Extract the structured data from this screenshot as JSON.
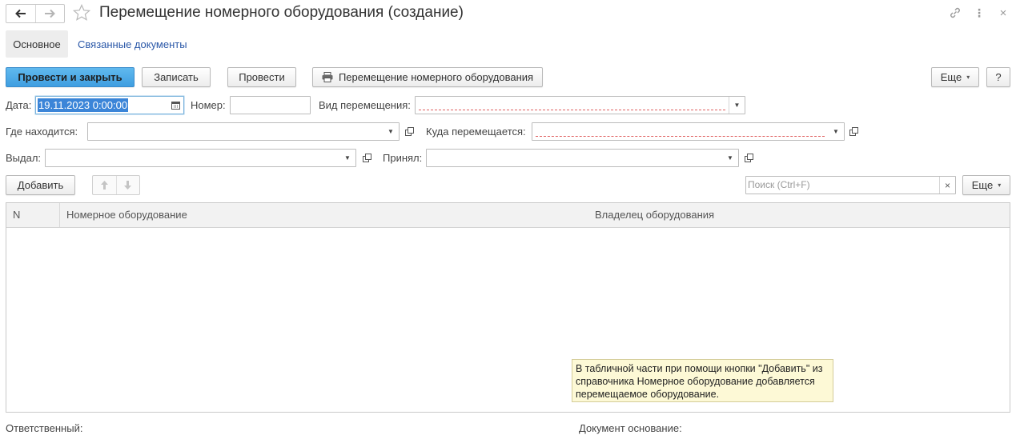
{
  "window": {
    "title": "Перемещение номерного оборудования (создание)",
    "menu_glyph": "⋮",
    "close_glyph": "×"
  },
  "tabs": [
    {
      "label": "Основное",
      "active": true
    },
    {
      "label": "Связанные документы",
      "active": false
    }
  ],
  "toolbar": {
    "post_close": "Провести и закрыть",
    "save": "Записать",
    "post": "Провести",
    "print": "Перемещение номерного оборудования",
    "more": "Еще",
    "help": "?"
  },
  "form": {
    "date_label": "Дата:",
    "date_value": "19.11.2023  0:00:00",
    "number_label": "Номер:",
    "number_value": "",
    "move_type_label": "Вид перемещения:",
    "move_type_value": "",
    "location_label": "Где находится:",
    "location_value": "",
    "destination_label": "Куда перемещается:",
    "destination_value": "",
    "issued_label": "Выдал:",
    "issued_value": "",
    "received_label": "Принял:",
    "received_value": ""
  },
  "table_toolbar": {
    "add": "Добавить",
    "search_placeholder": "Поиск (Ctrl+F)",
    "clear_glyph": "×",
    "more": "Еще"
  },
  "table": {
    "columns": [
      "N",
      "Номерное оборудование",
      "Владелец оборудования"
    ],
    "rows": []
  },
  "tooltip": {
    "text": "В табличной части при помощи кнопки \"Добавить\" из справочника Номерное оборудование добавляется перемещаемое оборудование."
  },
  "footer": {
    "responsible_label": "Ответственный:",
    "basis_label": "Документ основание:"
  },
  "colors": {
    "accent": "#3f9ee0",
    "link": "#2b58a8",
    "selection": "#3b85d8",
    "tooltip_bg": "#fdf9d6"
  }
}
